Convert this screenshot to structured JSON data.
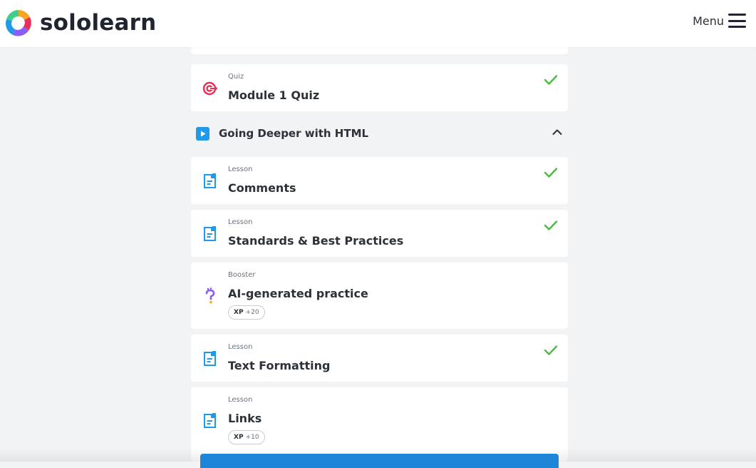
{
  "header": {
    "brand": "sololearn",
    "menu_label": "Menu"
  },
  "colors": {
    "accent_blue": "#1e9ae8",
    "check_green": "#4cb944",
    "quiz_red": "#e8305b",
    "booster_purple": "#8b5cf6"
  },
  "module": {
    "quiz": {
      "type": "Quiz",
      "title": "Module 1 Quiz",
      "completed": true,
      "icon": "target-icon"
    }
  },
  "section": {
    "title": "Going Deeper with HTML",
    "expanded": true
  },
  "items": [
    {
      "type": "Lesson",
      "title": "Comments",
      "completed": true,
      "icon": "lesson-icon"
    },
    {
      "type": "Lesson",
      "title": "Standards & Best Practices",
      "completed": true,
      "icon": "lesson-icon"
    },
    {
      "type": "Booster",
      "title": "AI-generated practice",
      "completed": false,
      "icon": "question-icon",
      "xp_label": "XP",
      "xp_value": "+20"
    },
    {
      "type": "Lesson",
      "title": "Text Formatting",
      "completed": true,
      "icon": "lesson-icon"
    },
    {
      "type": "Lesson",
      "title": "Links",
      "completed": false,
      "icon": "lesson-icon",
      "xp_label": "XP",
      "xp_value": "+10"
    }
  ]
}
